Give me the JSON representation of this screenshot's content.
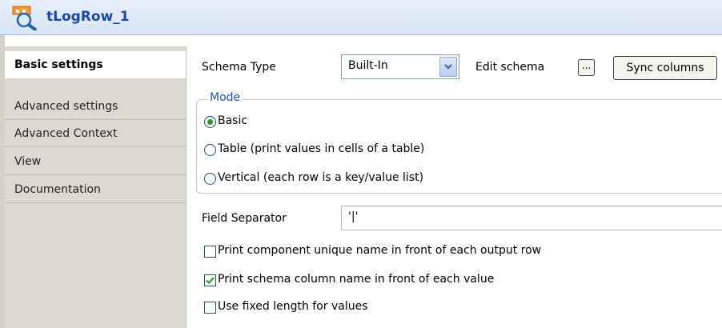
{
  "title": {
    "text": "tLogRow_1",
    "icon": "component-icon"
  },
  "sidebar": {
    "tabs": [
      {
        "label": "Basic settings",
        "active": true
      },
      {
        "label": "Advanced settings",
        "active": false
      },
      {
        "label": "Advanced Context",
        "active": false
      },
      {
        "label": "View",
        "active": false
      },
      {
        "label": "Documentation",
        "active": false
      }
    ]
  },
  "schema": {
    "label": "Schema Type",
    "value": "Built-In",
    "edit_label": "Edit schema",
    "edit_button": "...",
    "sync_button": "Sync columns"
  },
  "mode": {
    "legend": "Mode",
    "options": [
      {
        "label": "Basic",
        "selected": true
      },
      {
        "label": "Table (print values in cells of a table)",
        "selected": false
      },
      {
        "label": "Vertical (each row is a key/value list)",
        "selected": false
      }
    ]
  },
  "separator": {
    "label": "Field Separator",
    "value": "'|'"
  },
  "options": [
    {
      "label": "Print component unique name in front of each output row",
      "checked": false
    },
    {
      "label": "Print schema column name in front of each value",
      "checked": true
    },
    {
      "label": "Use fixed length for values",
      "checked": false
    }
  ],
  "colors": {
    "accent": "#1c4fc4",
    "title": "#1a47a8",
    "check": "#21a121"
  }
}
